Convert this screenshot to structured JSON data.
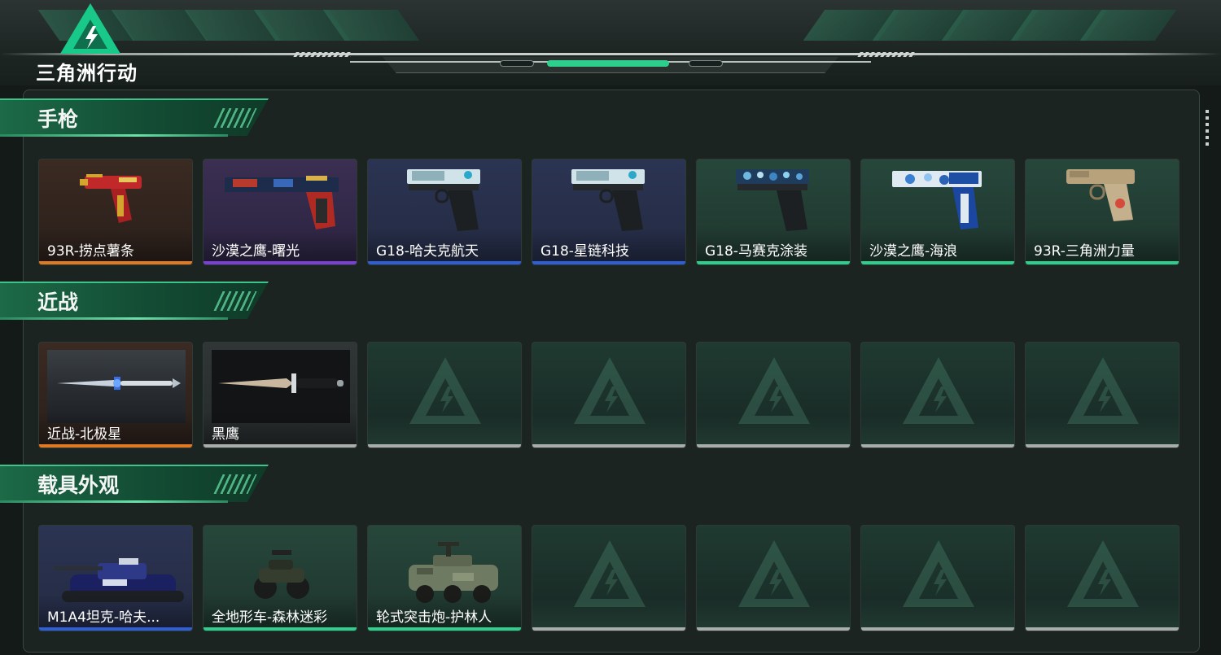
{
  "app": {
    "logo_text": "三角洲行动"
  },
  "colors": {
    "accent": "#2ecf8d",
    "rarity_orange": "#e07a22",
    "rarity_purple": "#7b3fd6",
    "rarity_blue": "#2f5fd6",
    "rarity_green": "#2ecf8d",
    "rarity_grey": "#a9aeac"
  },
  "sections": [
    {
      "title": "手枪",
      "items": [
        {
          "label": "93R-捞点薯条",
          "rarity": "orange",
          "icon": "pistol-red-gold"
        },
        {
          "label": "沙漠之鹰-曙光",
          "rarity": "purple",
          "icon": "desert-eagle-graffiti"
        },
        {
          "label": "G18-哈夫克航天",
          "rarity": "blue",
          "icon": "glock-white"
        },
        {
          "label": "G18-星链科技",
          "rarity": "blue",
          "icon": "glock-white"
        },
        {
          "label": "G18-马赛克涂装",
          "rarity": "green",
          "icon": "glock-mosaic"
        },
        {
          "label": "沙漠之鹰-海浪",
          "rarity": "green",
          "icon": "desert-eagle-blue"
        },
        {
          "label": "93R-三角洲力量",
          "rarity": "green",
          "icon": "pistol-tan"
        }
      ]
    },
    {
      "title": "近战",
      "items": [
        {
          "label": "近战-北极星",
          "rarity": "orange",
          "icon": "dagger-blue"
        },
        {
          "label": "黑鹰",
          "rarity": "grey",
          "icon": "combat-knife"
        },
        {
          "label": "",
          "rarity": "empty",
          "icon": "empty-slot-icon"
        },
        {
          "label": "",
          "rarity": "empty",
          "icon": "empty-slot-icon"
        },
        {
          "label": "",
          "rarity": "empty",
          "icon": "empty-slot-icon"
        },
        {
          "label": "",
          "rarity": "empty",
          "icon": "empty-slot-icon"
        },
        {
          "label": "",
          "rarity": "empty",
          "icon": "empty-slot-icon"
        }
      ]
    },
    {
      "title": "载具外观",
      "items": [
        {
          "label": "M1A4坦克-哈夫...",
          "rarity": "blue",
          "icon": "tank"
        },
        {
          "label": "全地形车-森林迷彩",
          "rarity": "green",
          "icon": "atv"
        },
        {
          "label": "轮式突击炮-护林人",
          "rarity": "green",
          "icon": "armored-car"
        },
        {
          "label": "",
          "rarity": "empty",
          "icon": "empty-slot-icon"
        },
        {
          "label": "",
          "rarity": "empty",
          "icon": "empty-slot-icon"
        },
        {
          "label": "",
          "rarity": "empty",
          "icon": "empty-slot-icon"
        },
        {
          "label": "",
          "rarity": "empty",
          "icon": "empty-slot-icon"
        }
      ]
    }
  ]
}
